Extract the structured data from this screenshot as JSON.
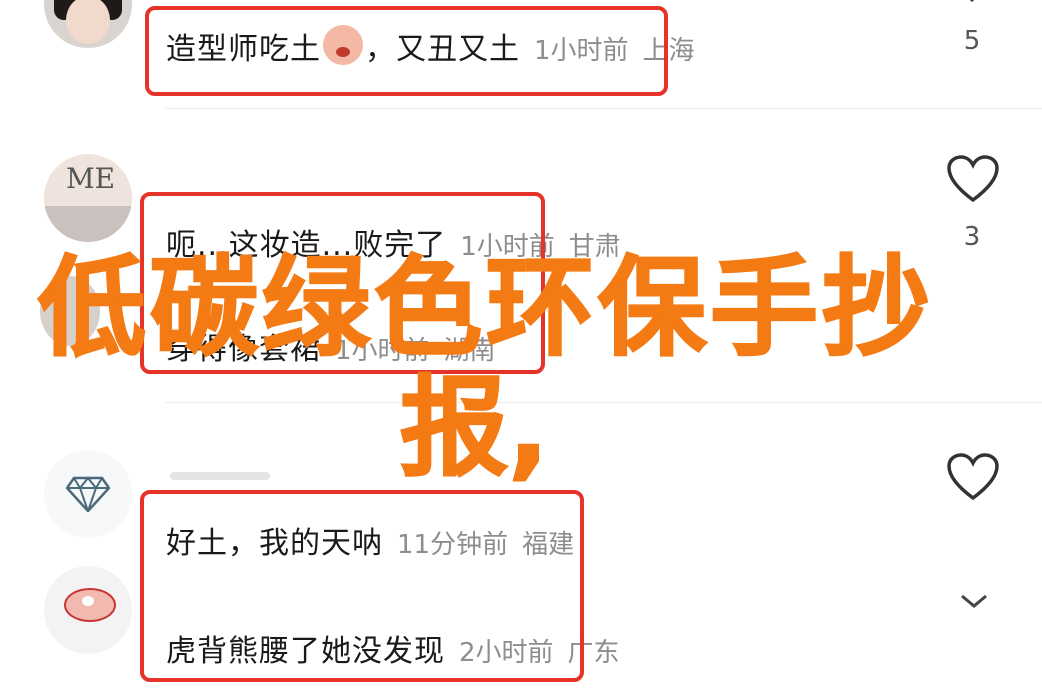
{
  "comments": [
    {
      "text": "造型师吃土",
      "text_after_emoji": "，又丑又土",
      "time": "1小时前",
      "location": "上海",
      "likes": "5"
    },
    {
      "text": "呃...这妆造...败完了",
      "time": "1小时前",
      "location": "甘肃",
      "likes": "3"
    },
    {
      "text": "穿得像套裙",
      "time": "1小时前",
      "location": "湖南"
    },
    {
      "text": "好土，我的天呐",
      "time": "11分钟前",
      "location": "福建"
    },
    {
      "text": "虎背熊腰了她没发现",
      "time": "2小时前",
      "location": "广东"
    }
  ],
  "overlay_title": {
    "line1": "低碳绿色环保手抄",
    "line2": "报,"
  },
  "colors": {
    "accent_red": "#e5332a",
    "overlay_orange": "#f47a14"
  },
  "icons": [
    "heart-icon",
    "chevron-down-icon",
    "diamond-icon"
  ]
}
